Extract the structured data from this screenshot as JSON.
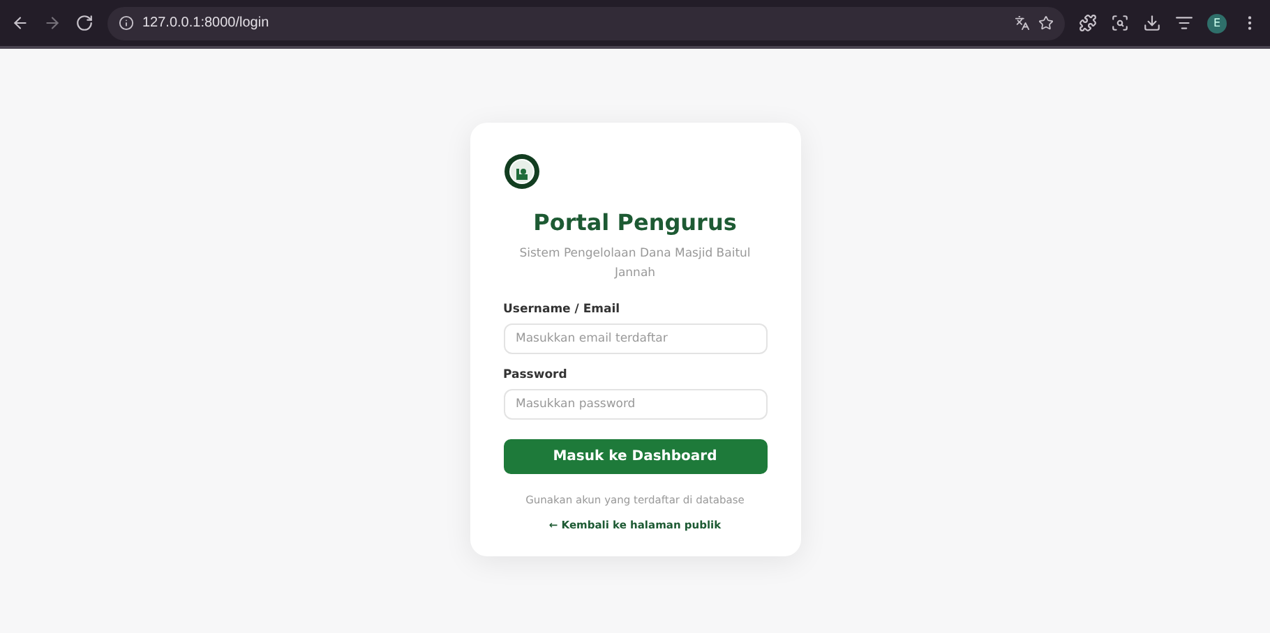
{
  "browser": {
    "url": "127.0.0.1:8000/login",
    "profile_initial": "E"
  },
  "login": {
    "title": "Portal Pengurus",
    "subtitle": "Sistem Pengelolaan Dana Masjid Baitul Jannah",
    "fields": [
      {
        "label": "Username / Email",
        "placeholder": "Masukkan email terdaftar"
      },
      {
        "label": "Password",
        "placeholder": "Masukkan password"
      }
    ],
    "submit": "Masuk ke Dashboard",
    "note": "Gunakan akun yang terdaftar di database",
    "back_link": "← Kembali ke halaman publik"
  }
}
